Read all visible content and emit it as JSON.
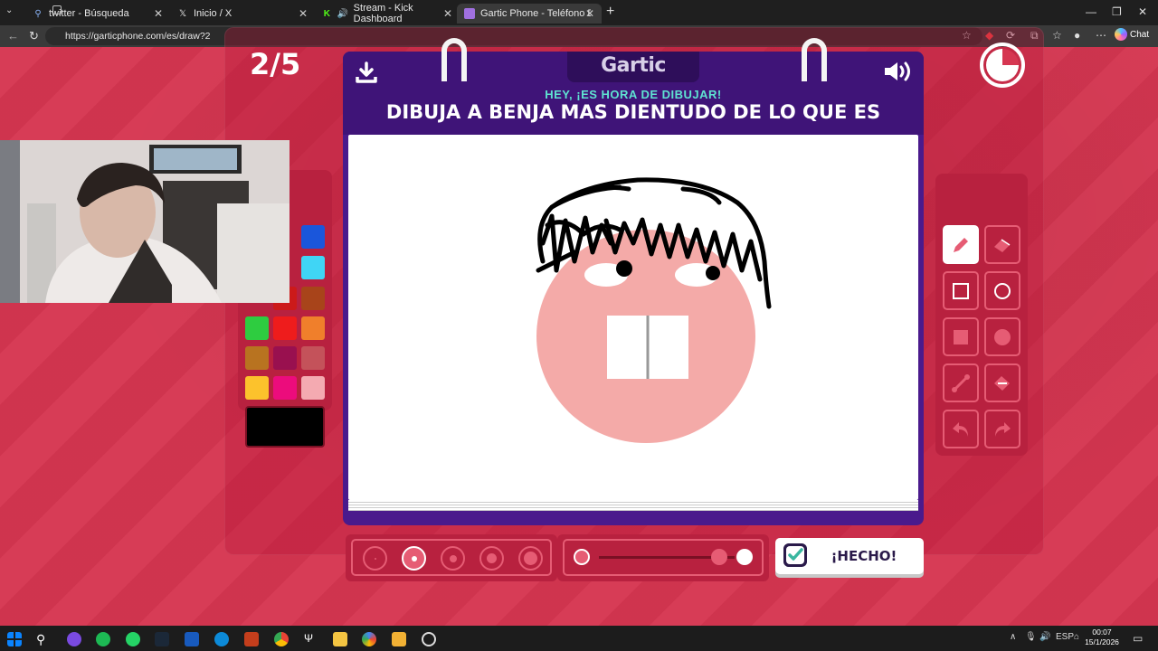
{
  "browser": {
    "tabs": [
      {
        "title": "twitter - Búsqueda",
        "active": false
      },
      {
        "title": "Inicio / X",
        "active": false
      },
      {
        "title": "Stream - Kick Dashboard",
        "active": false
      },
      {
        "title": "Gartic Phone - Teléfono Descomp",
        "active": true
      }
    ],
    "url": "https://garticphone.com/es/draw?2",
    "chat_label": "Chat"
  },
  "game": {
    "round_counter": "2/5",
    "logo": "Gartic",
    "subtitle": "HEY, ¡ES HORA DE DIBUJAR!",
    "prompt": "DIBUJA A BENJA MAS DIENTUDO DE LO QUE ES",
    "done_label": "¡HECHO!",
    "colors": [
      "#000000",
      "#1a56db",
      "#666666",
      "#40d5f5",
      "#cc1a1a",
      "#a8441a",
      "#2ecc40",
      "#ee1c1c",
      "#f07f2b",
      "#b87320",
      "#99104f",
      "#c4525a",
      "#fcc22c",
      "#ec0c7c",
      "#f4aab1"
    ],
    "current_color": "#000000",
    "brush_sizes": 5,
    "active_brush_index": 1,
    "tools": [
      "pencil-icon",
      "eraser-icon",
      "rectangle-outline-icon",
      "circle-outline-icon",
      "rectangle-fill-icon",
      "circle-fill-icon",
      "line-icon",
      "fill-bucket-icon",
      "undo-icon",
      "redo-icon"
    ],
    "active_tool": "pencil-icon",
    "opacity_value": 0.9
  },
  "taskbar": {
    "time": "00:07",
    "date": "15/1/2026",
    "lang": "ESP"
  }
}
